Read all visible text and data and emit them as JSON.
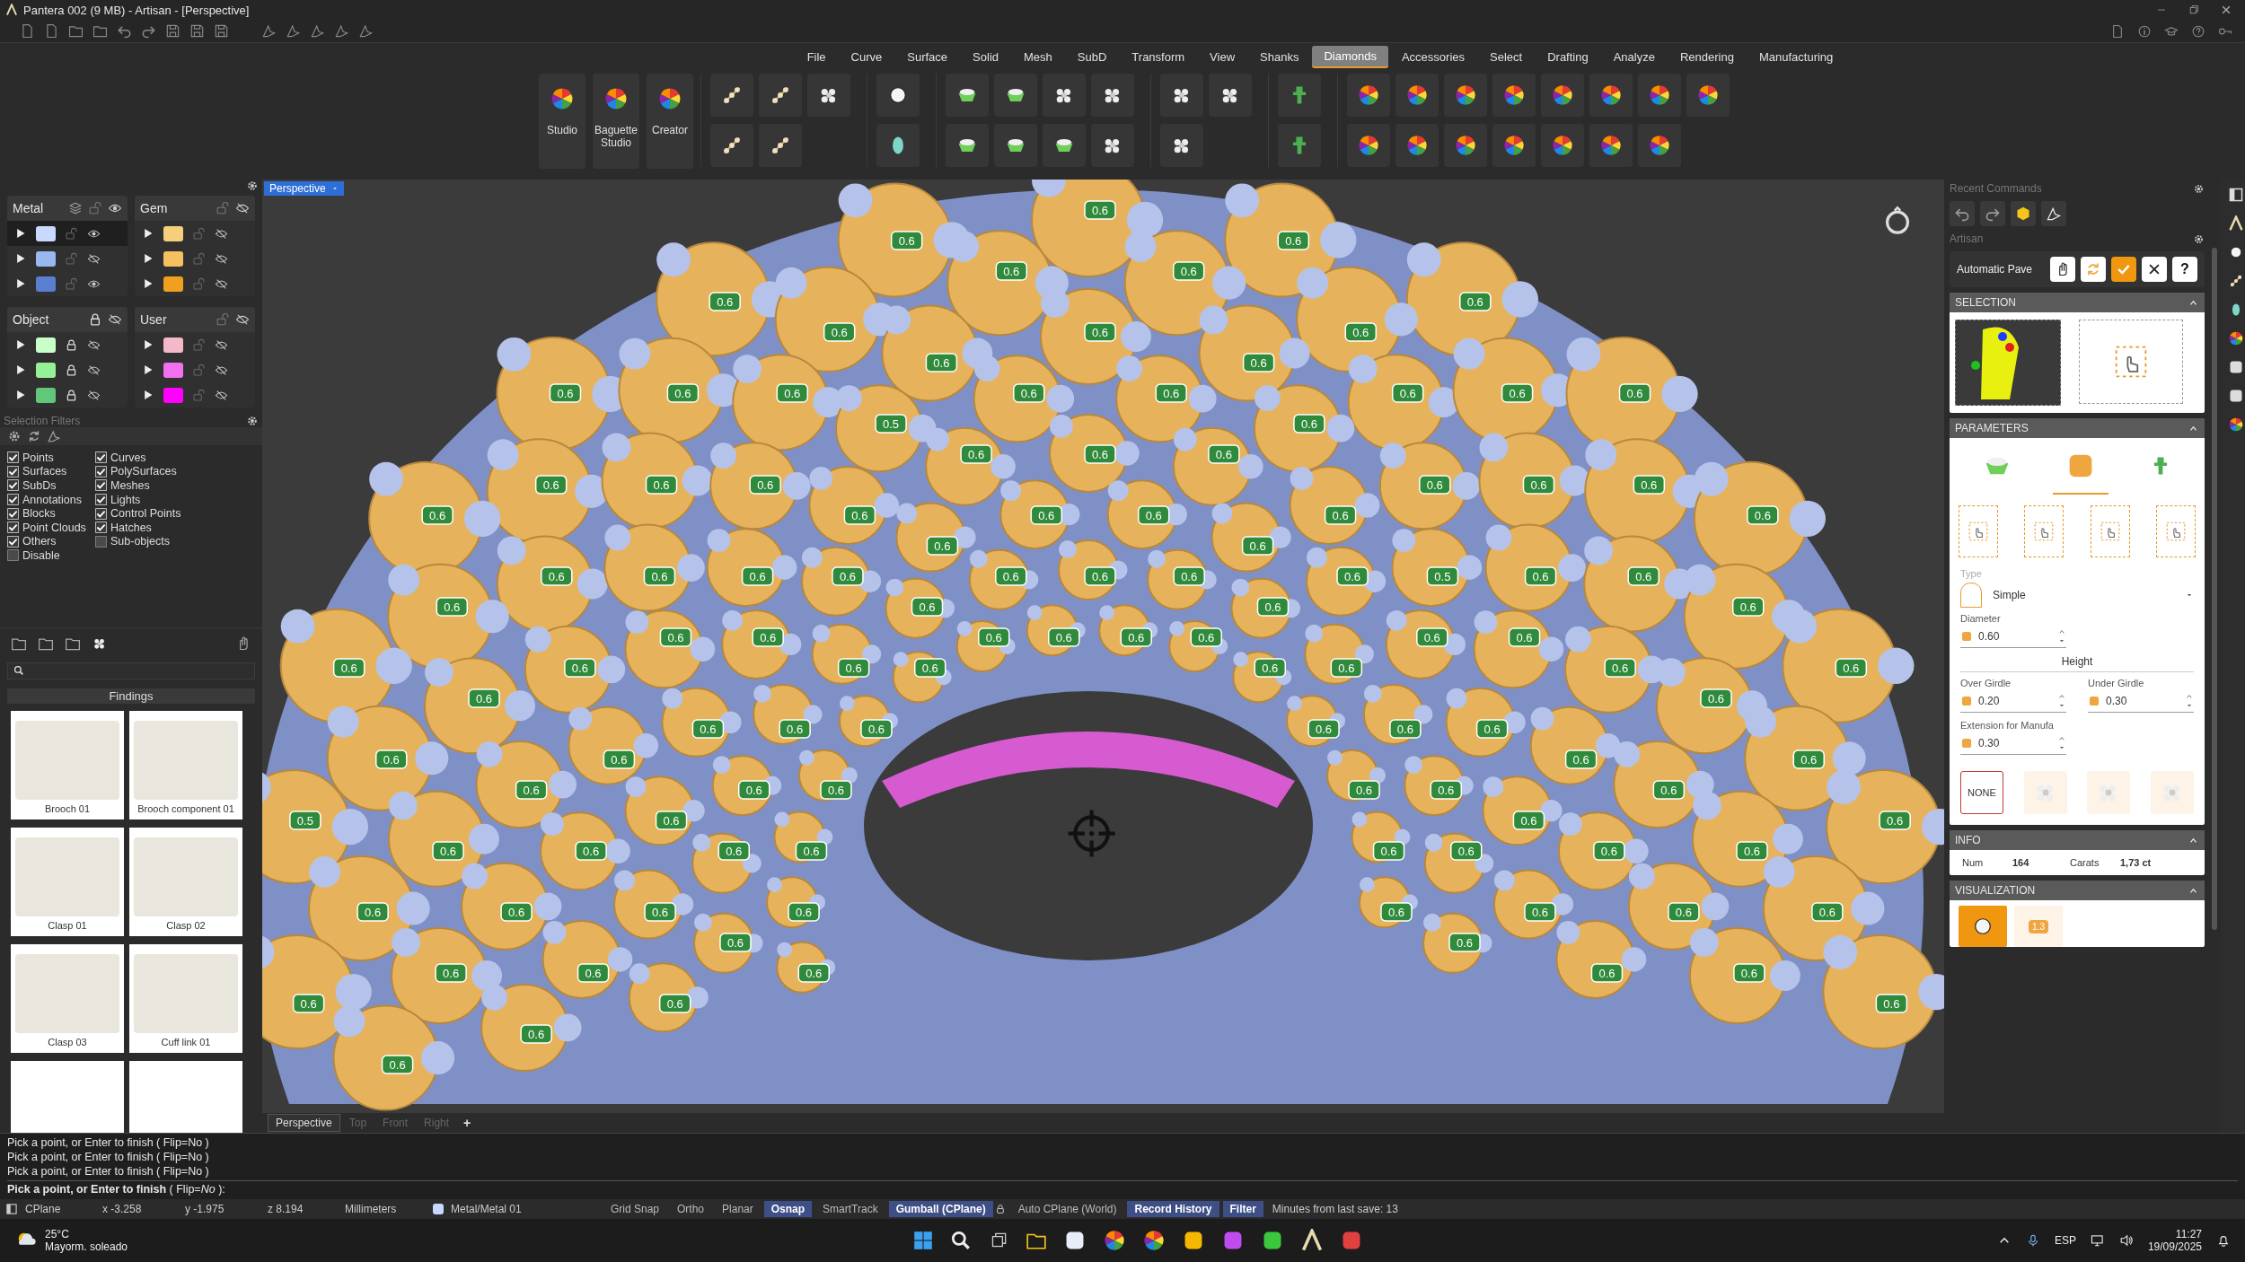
{
  "window": {
    "title": "Pantera 002 (9 MB) - Artisan - [Perspective]"
  },
  "menu": [
    {
      "label": "File",
      "selected": false
    },
    {
      "label": "Curve",
      "selected": false
    },
    {
      "label": "Surface",
      "selected": false
    },
    {
      "label": "Solid",
      "selected": false
    },
    {
      "label": "Mesh",
      "selected": false
    },
    {
      "label": "SubD",
      "selected": false
    },
    {
      "label": "Transform",
      "selected": false
    },
    {
      "label": "View",
      "selected": false
    },
    {
      "label": "Shanks",
      "selected": false
    },
    {
      "label": "Diamonds",
      "selected": true
    },
    {
      "label": "Accessories",
      "selected": false
    },
    {
      "label": "Select",
      "selected": false
    },
    {
      "label": "Drafting",
      "selected": false
    },
    {
      "label": "Analyze",
      "selected": false
    },
    {
      "label": "Rendering",
      "selected": false
    },
    {
      "label": "Manufacturing",
      "selected": false
    }
  ],
  "ribbon": {
    "large_buttons": [
      "Studio",
      "Baguette Studio",
      "Creator"
    ]
  },
  "layer_groups": [
    {
      "name": "Metal",
      "locked": false,
      "visible": true,
      "layers": [
        {
          "color": "#c8d8ff",
          "locked": false,
          "visible": true,
          "selected": true
        },
        {
          "color": "#9ab8f0",
          "locked": false,
          "visible": false,
          "selected": false
        },
        {
          "color": "#5a7fd0",
          "locked": false,
          "visible": true,
          "selected": false
        }
      ]
    },
    {
      "name": "Gem",
      "locked": false,
      "visible": false,
      "layers": [
        {
          "color": "#f5cf7a",
          "locked": false,
          "visible": false,
          "selected": false
        },
        {
          "color": "#f5c060",
          "locked": false,
          "visible": false,
          "selected": false
        },
        {
          "color": "#f0a020",
          "locked": false,
          "visible": false,
          "selected": false
        }
      ]
    },
    {
      "name": "Object",
      "locked": true,
      "visible": false,
      "layers": [
        {
          "color": "#c8ffc8",
          "locked": true,
          "visible": false,
          "selected": false
        },
        {
          "color": "#96f096",
          "locked": true,
          "visible": false,
          "selected": false
        },
        {
          "color": "#60c878",
          "locked": true,
          "visible": false,
          "selected": false
        }
      ]
    },
    {
      "name": "User",
      "locked": false,
      "visible": false,
      "layers": [
        {
          "color": "#f5b8c8",
          "locked": false,
          "visible": false,
          "selected": false
        },
        {
          "color": "#f070f0",
          "locked": false,
          "visible": false,
          "selected": false
        },
        {
          "color": "#ff00ff",
          "locked": false,
          "visible": false,
          "selected": false
        }
      ]
    }
  ],
  "selection_filters": {
    "title": "Selection Filters",
    "filters": [
      {
        "label": "Points",
        "checked": true
      },
      {
        "label": "Curves",
        "checked": true
      },
      {
        "label": "Surfaces",
        "checked": true
      },
      {
        "label": "PolySurfaces",
        "checked": true
      },
      {
        "label": "SubDs",
        "checked": true
      },
      {
        "label": "Meshes",
        "checked": true
      },
      {
        "label": "Annotations",
        "checked": true
      },
      {
        "label": "Lights",
        "checked": true
      },
      {
        "label": "Blocks",
        "checked": true
      },
      {
        "label": "Control Points",
        "checked": true
      },
      {
        "label": "Point Clouds",
        "checked": true
      },
      {
        "label": "Hatches",
        "checked": true
      },
      {
        "label": "Others",
        "checked": true
      },
      {
        "label": "Sub-objects",
        "checked": false
      },
      {
        "label": "Disable",
        "checked": false
      }
    ]
  },
  "library": {
    "category": "Findings",
    "items": [
      {
        "name": "Brooch 01"
      },
      {
        "name": "Brooch component 01"
      },
      {
        "name": "Clasp 01"
      },
      {
        "name": "Clasp 02"
      },
      {
        "name": "Clasp 03"
      },
      {
        "name": "Cuff link 01"
      }
    ]
  },
  "viewport": {
    "view_label": "Perspective",
    "gem_labels": [
      "0.6",
      "0.6",
      "0.6",
      "0.6",
      "0.6",
      "0.6",
      "0.6",
      "0.6",
      "0.6",
      "0.6",
      "0.6",
      "0.6",
      "0.6",
      "0.6",
      "0.6",
      "0.6",
      "0.6",
      "0.6",
      "0.6",
      "0.6",
      "0.5",
      "0.6",
      "0.6",
      "0.6",
      "0.6",
      "0.6",
      "0.6",
      "0.6",
      "0.6",
      "0.6",
      "0.6",
      "0.6",
      "0.6",
      "0.6",
      "0.6",
      "0.6",
      "0.6",
      "0.6",
      "0.6",
      "0.6",
      "0.6",
      "0.6",
      "0.6",
      "0.6",
      "0.6",
      "0.6",
      "0.6",
      "0.5",
      "0.6",
      "0.6",
      "0.6",
      "0.6",
      "0.6",
      "0.6",
      "0.6",
      "0.6",
      "0.6",
      "0.6",
      "0.6",
      "0.6",
      "0.6",
      "0.6",
      "0.6",
      "0.6",
      "0.6",
      "0.6",
      "0.6",
      "0.6",
      "0.6",
      "0.6",
      "0.6",
      "0.6",
      "0.6",
      "0.6",
      "0.6",
      "0.6",
      "0.6",
      "0.6",
      "0.6",
      "0.6",
      "0.6",
      "0.6",
      "0.6",
      "0.6",
      "0.6",
      "0.6",
      "0.6",
      "0.6",
      "0.5",
      "0.6",
      "0.6",
      "0.6",
      "0.6",
      "0.6",
      "0.6",
      "0.6",
      "0.6",
      "0.6",
      "0.6",
      "0.6",
      "0.6",
      "0.6",
      "0.6",
      "0.6",
      "0.6",
      "0.6",
      "0.6",
      "0.6",
      "0.6",
      "0.6",
      "0.6",
      "0.6",
      "0.6",
      "0.6",
      "0.6",
      "0.6",
      "0.6",
      "0.6",
      "0.6",
      "0.6"
    ]
  },
  "view_tabs": [
    {
      "label": "Perspective",
      "selected": true
    },
    {
      "label": "Top",
      "selected": false
    },
    {
      "label": "Front",
      "selected": false
    },
    {
      "label": "Right",
      "selected": false
    }
  ],
  "add_view": "+",
  "command_history": [
    "Pick a point, or Enter to finish ( Flip=No )",
    "Pick a point, or Enter to finish ( Flip=No )",
    "Pick a point, or Enter to finish ( Flip=No )"
  ],
  "command_prompt": "**Pick a point, or Enter to finish** ( Flip=*No* ):",
  "status_bar": {
    "cplane": "CPlane",
    "x": "x -3.258",
    "y": "y -1.975",
    "z": "z 8.194",
    "units": "Millimeters",
    "layer": "Metal/Metal 01",
    "toggles": [
      {
        "label": "Grid Snap",
        "on": false,
        "kind": "toggle"
      },
      {
        "label": "Ortho",
        "on": false,
        "kind": "toggle"
      },
      {
        "label": "Planar",
        "on": false,
        "kind": "toggle"
      },
      {
        "label": "Osnap",
        "on": true,
        "kind": "toggle"
      },
      {
        "label": "SmartTrack",
        "on": false,
        "kind": "toggle"
      },
      {
        "label": "Gumball (CPlane)",
        "on": true,
        "kind": "toggle"
      },
      {
        "label": "Auto CPlane (World)",
        "on": false,
        "kind": "lock"
      },
      {
        "label": "Record History",
        "on": true,
        "kind": "toggle"
      },
      {
        "label": "Filter",
        "on": true,
        "kind": "toggle"
      }
    ],
    "save_info": "Minutes from last save: 13"
  },
  "right_panel": {
    "recent_title": "Recent Commands",
    "artisan_title": "Artisan",
    "command": "Automatic Pave",
    "help": "?",
    "selection": {
      "title": "SELECTION"
    },
    "parameters": {
      "title": "PARAMETERS",
      "modes": [
        {
          "kind": "cup",
          "selected": false
        },
        {
          "kind": "frame",
          "selected": true
        },
        {
          "kind": "pin",
          "selected": false
        }
      ],
      "type_label": "Type",
      "type_value": "Simple",
      "diameter": {
        "label": "Diameter",
        "value": "0.60"
      },
      "height_title": "Height",
      "over_girdle": {
        "label": "Over Girdle",
        "value": "0.20"
      },
      "under_girdle": {
        "label": "Under Girdle",
        "value": "0.30"
      },
      "extension": {
        "label": "Extension for Manufa",
        "value": "0.30"
      },
      "patterns": [
        {
          "kind": "none",
          "label": "NONE",
          "selected": true
        },
        {
          "kind": "vertical",
          "selected": false
        },
        {
          "kind": "horizontal",
          "selected": false
        },
        {
          "kind": "cross",
          "selected": false
        }
      ]
    },
    "info": {
      "title": "INFO",
      "fields": [
        {
          "label": "Num",
          "value": "164"
        },
        {
          "label": "Carats",
          "value": "1,73 ct"
        }
      ]
    },
    "visualization": {
      "title": "VISUALIZATION",
      "modes": [
        {
          "kind": "shade",
          "selected": true
        },
        {
          "kind": "size",
          "label": "1.3",
          "selected": false
        }
      ]
    }
  },
  "taskbar": {
    "temperature": "25°C",
    "weather": "Mayorm. soleado",
    "language": "ESP",
    "time": "11:27",
    "date": "19/09/2025"
  }
}
